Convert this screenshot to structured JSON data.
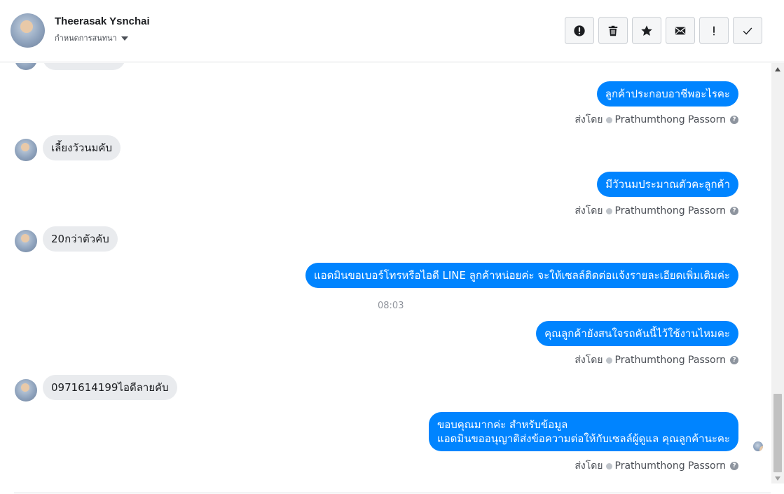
{
  "header": {
    "contact_name": "Theerasak Ysnchai",
    "assign_label": "กำหนดการสนทนา",
    "toolbar": [
      {
        "name": "spam-button",
        "icon": "alert-circle-icon"
      },
      {
        "name": "delete-button",
        "icon": "trash-icon"
      },
      {
        "name": "star-button",
        "icon": "star-icon"
      },
      {
        "name": "mark-unread-button",
        "icon": "envelope-icon"
      },
      {
        "name": "follow-up-button",
        "icon": "exclamation-icon"
      },
      {
        "name": "mark-done-button",
        "icon": "checkmark-icon"
      }
    ]
  },
  "thread": {
    "sent_by_label": "ส่งโดย",
    "sender_name": "Prathumthong Passorn",
    "messages": [
      {
        "direction": "out",
        "text": "ลูกค้าประกอบอาชีพอะไรคะ",
        "sent_by": true
      },
      {
        "direction": "in",
        "text": "เลี้ยงวัวนมคับ"
      },
      {
        "direction": "out",
        "text": "มีวัวนมประมาณตัวคะลูกค้า",
        "sent_by": true
      },
      {
        "direction": "in",
        "text": "20กว่าตัวคับ"
      },
      {
        "direction": "out",
        "text": "แอดมินขอเบอร์โทรหรือไอดี LINE ลูกค้าหน่อยค่ะ จะให้เซลล์ติดต่อแจ้งรายละเอียดเพิ่มเติมค่ะ"
      },
      {
        "direction": "out",
        "text": "คุณลูกค้ายังสนใจรถคันนี้ไว้ใช้งานไหมคะ",
        "sent_by": true
      },
      {
        "direction": "in",
        "text": "0971614199ไอดีลายคับ"
      },
      {
        "direction": "out",
        "text_line1": "ขอบคุณมากค่ะ สำหรับข้อมูล",
        "text_line2": "แอดมินขออนุญาติส่งข้อความต่อให้กับเซลล์ผู้ดูแล คุณลูกค้านะคะ",
        "sent_by": true
      }
    ],
    "timestamp": "08:03"
  }
}
